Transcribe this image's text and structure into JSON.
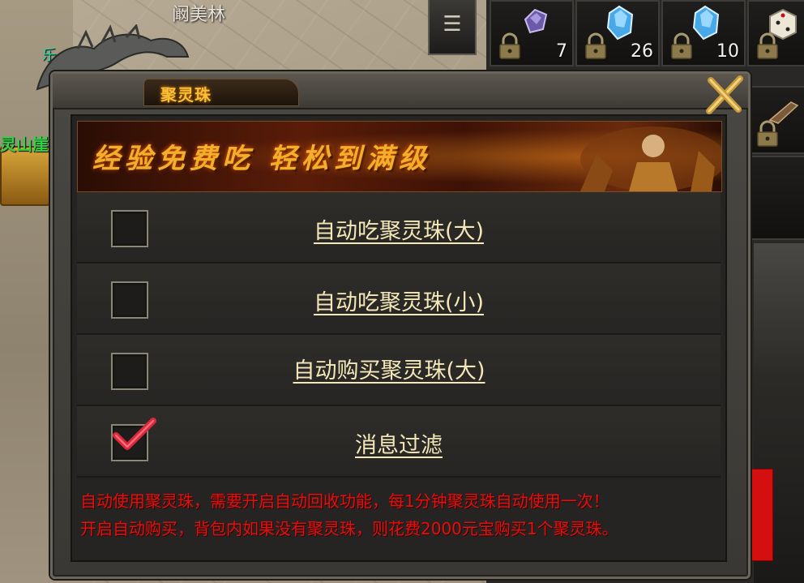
{
  "scene": {
    "npc_name": "阚美林",
    "map_label_top": "乐",
    "map_label_side": "灵山崖"
  },
  "menu": {
    "icon": "hamburger-icon",
    "glyph": "☰"
  },
  "inventory": {
    "slots": [
      {
        "item": "purple-gem",
        "count": "7",
        "locked": true
      },
      {
        "item": "blue-crystal",
        "count": "26",
        "locked": true
      },
      {
        "item": "blue-crystal",
        "count": "10",
        "locked": true
      },
      {
        "item": "dice",
        "count": "",
        "locked": true
      },
      {
        "item": "unknown",
        "count": "",
        "locked": true
      }
    ]
  },
  "dialog": {
    "title": "聚灵珠",
    "banner_text": "经验免费吃  轻松到满级",
    "options": [
      {
        "label": "自动吃聚灵珠(大)",
        "checked": false
      },
      {
        "label": "自动吃聚灵珠(小)",
        "checked": false
      },
      {
        "label": "自动购买聚灵珠(大)",
        "checked": false
      },
      {
        "label": "消息过滤",
        "checked": true
      }
    ],
    "notice_line1": "自动使用聚灵珠，需要开启自动回收功能，每1分钟聚灵珠自动使用一次！",
    "notice_line2": "开启自动购买，背包内如果没有聚灵珠，则花费2000元宝购买1个聚灵珠。"
  },
  "colors": {
    "title_gold": "#f5c038",
    "option_text": "#f4e8b8",
    "notice_red": "#e31010",
    "check_red": "#d8283a"
  }
}
